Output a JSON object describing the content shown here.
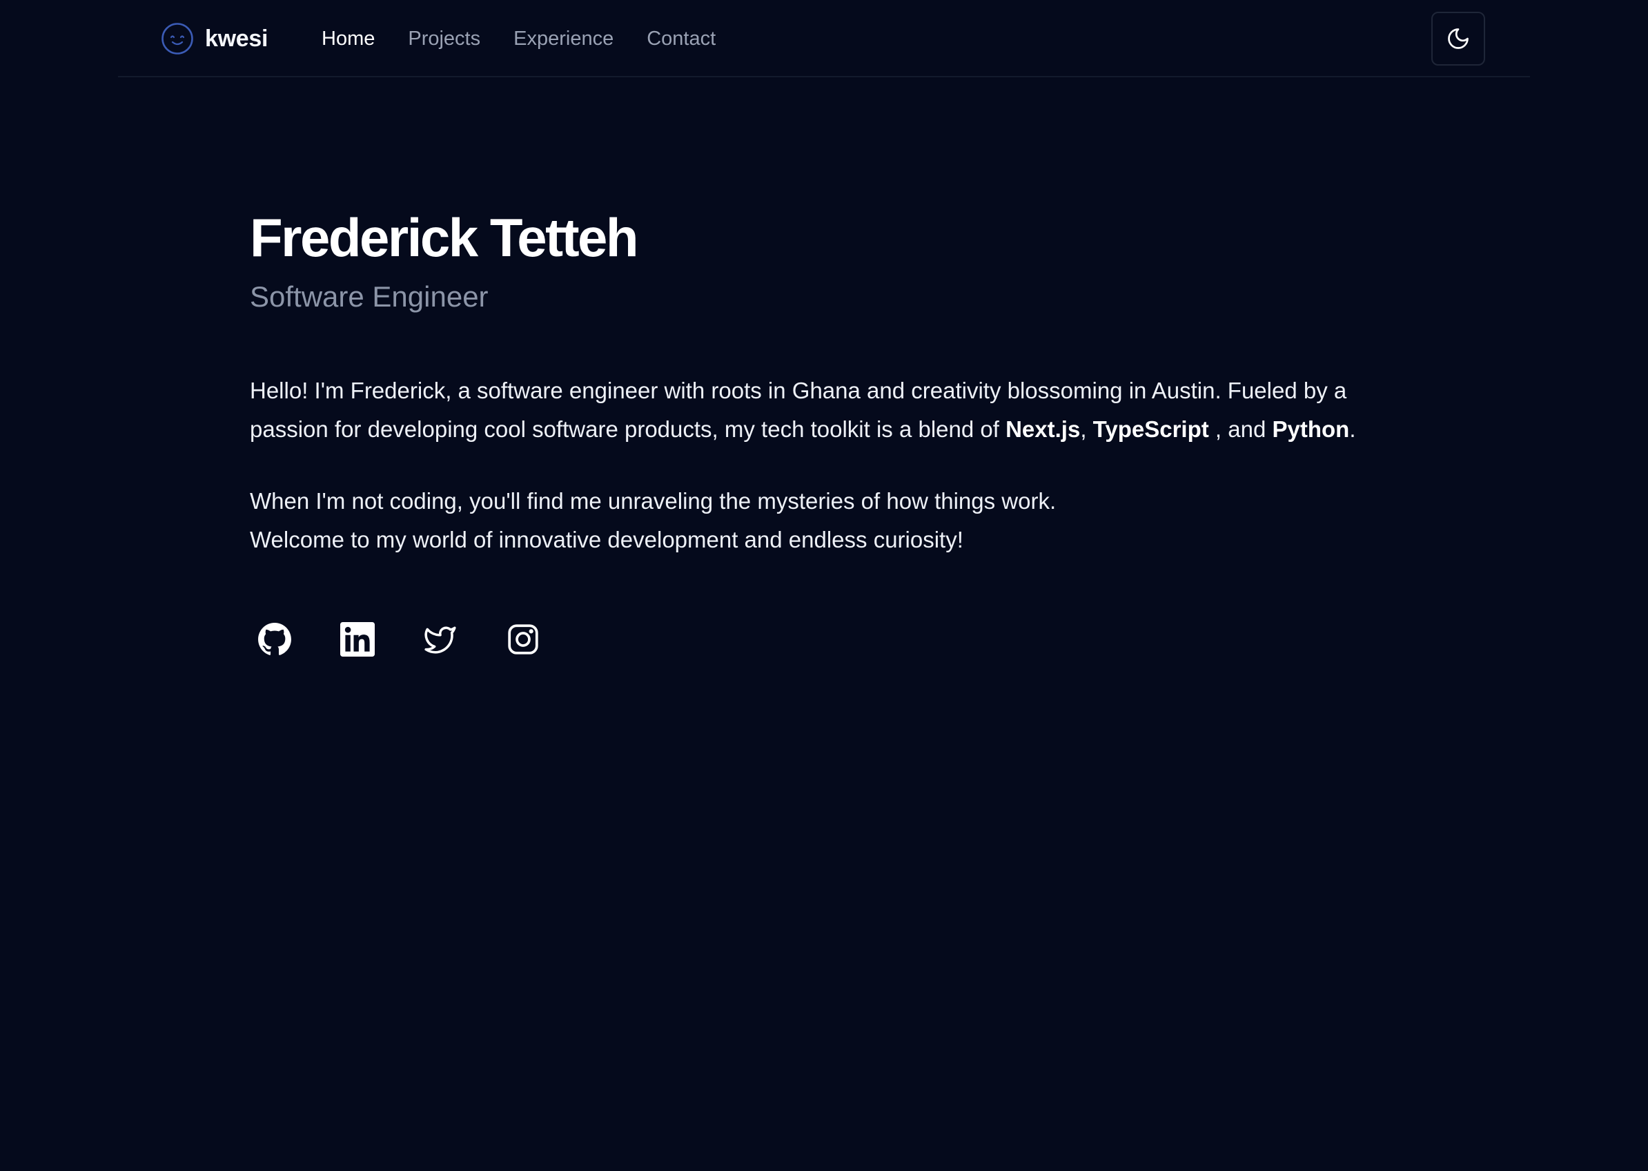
{
  "header": {
    "logo_text": "kwesi",
    "logo_icon": "smiley-face-icon",
    "nav": [
      {
        "label": "Home",
        "active": true
      },
      {
        "label": "Projects",
        "active": false
      },
      {
        "label": "Experience",
        "active": false
      },
      {
        "label": "Contact",
        "active": false
      }
    ],
    "theme_toggle_icon": "moon-icon"
  },
  "hero": {
    "name": "Frederick Tetteh",
    "role": "Software Engineer"
  },
  "about": {
    "p1_text": "Hello! I'm Frederick, a software engineer with roots in Ghana and creativity blossoming in Austin. Fueled by a passion for developing cool software products, my tech toolkit is a blend of ",
    "tech1": "Next.js",
    "sep1": ", ",
    "tech2": "TypeScript",
    "sep2": " , and ",
    "tech3": "Python",
    "p1_end": ".",
    "p2": "When I'm not coding, you'll find me unraveling the mysteries of how things work. Welcome to my world of innovative development and endless curiosity!"
  },
  "socials": [
    "github-icon",
    "linkedin-icon",
    "twitter-icon",
    "instagram-icon"
  ],
  "colors": {
    "background": "#050a1c",
    "text": "#ffffff",
    "muted": "#9aa2b4",
    "logo_accent": "#3b5bb5"
  }
}
